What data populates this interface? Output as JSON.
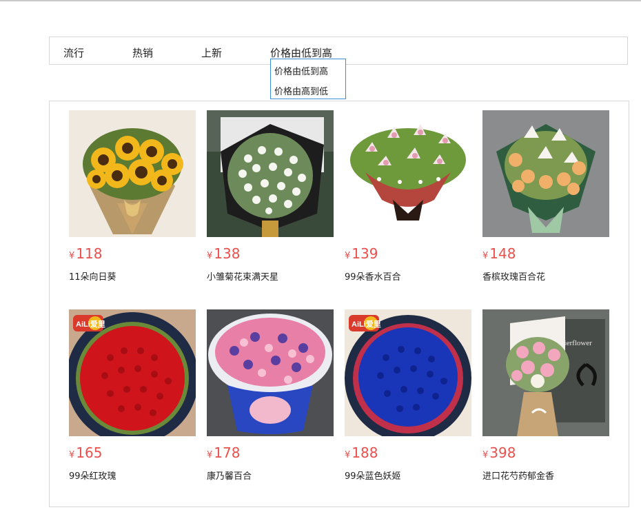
{
  "sort_tabs": [
    "流行",
    "热销",
    "上新",
    "价格由低到高"
  ],
  "sort_dropdown": {
    "options": [
      "价格由低到高",
      "价格由高到低"
    ],
    "border_color": "#3a8fd6"
  },
  "accent_color": "#e9504d",
  "currency_symbol": "¥",
  "products": [
    {
      "price": "118",
      "name": "11朵向日葵"
    },
    {
      "price": "138",
      "name": "小雏菊花束满天星"
    },
    {
      "price": "139",
      "name": "99朵香水百合"
    },
    {
      "price": "148",
      "name": "香槟玫瑰百合花"
    },
    {
      "price": "165",
      "name": "99朵红玫瑰"
    },
    {
      "price": "178",
      "name": "康乃馨百合"
    },
    {
      "price": "188",
      "name": "99朵蓝色妖姬"
    },
    {
      "price": "398",
      "name": "进口花芍药郁金香"
    }
  ],
  "image_overlays": {
    "brand_badge": "AiLi爱里",
    "box_brand": "mierflower"
  }
}
